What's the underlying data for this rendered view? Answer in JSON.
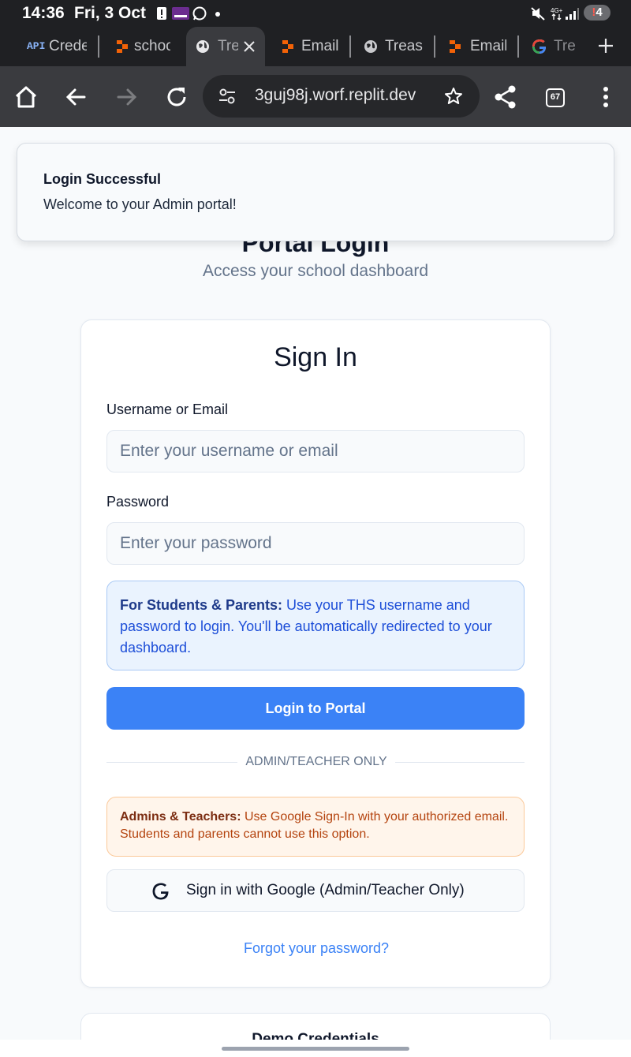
{
  "status_bar": {
    "time": "14:36",
    "date": "Fri, 3 Oct",
    "notification_badge": "4",
    "notification_badge_prefix": "!"
  },
  "tabs": [
    {
      "label": "Crede",
      "favicon": "api-icon"
    },
    {
      "label": "schoo",
      "favicon": "replit-icon"
    },
    {
      "label": "Tre",
      "favicon": "globe-icon",
      "active": true
    },
    {
      "label": "Email",
      "favicon": "replit-icon"
    },
    {
      "label": "Treas",
      "favicon": "globe-icon"
    },
    {
      "label": "Email",
      "favicon": "replit-icon"
    },
    {
      "label": "Tre",
      "favicon": "google-icon"
    }
  ],
  "api_label": "API",
  "toolbar": {
    "url": "3guj98j.worf.replit.dev",
    "tab_count": "67"
  },
  "toast": {
    "title": "Login Successful",
    "description": "Welcome to your Admin portal!"
  },
  "page": {
    "heading": "Portal Login",
    "subheading": "Access your school dashboard"
  },
  "login_card": {
    "title": "Sign In",
    "username_label": "Username or Email",
    "username_placeholder": "Enter your username or email",
    "password_label": "Password",
    "password_placeholder": "Enter your password",
    "students_note_bold": "For Students & Parents:",
    "students_note_text": " Use your THS username and password to login. You'll be automatically redirected to your dashboard.",
    "login_button": "Login to Portal",
    "divider_text": "ADMIN/TEACHER ONLY",
    "admins_note_bold": "Admins & Teachers:",
    "admins_note_text": " Use Google Sign-In with your authorized email. Students and parents cannot use this option.",
    "google_button": "Sign in with Google (Admin/Teacher Only)",
    "forgot_link": "Forgot your password?"
  },
  "demo_card": {
    "title": "Demo Credentials"
  },
  "colors": {
    "primary": "#3b82f6",
    "info_blue_bg": "#eaf3fe",
    "info_orange_bg": "#fff5eb",
    "browser_chrome": "#1f2023",
    "toolbar": "#3a3b3f"
  }
}
